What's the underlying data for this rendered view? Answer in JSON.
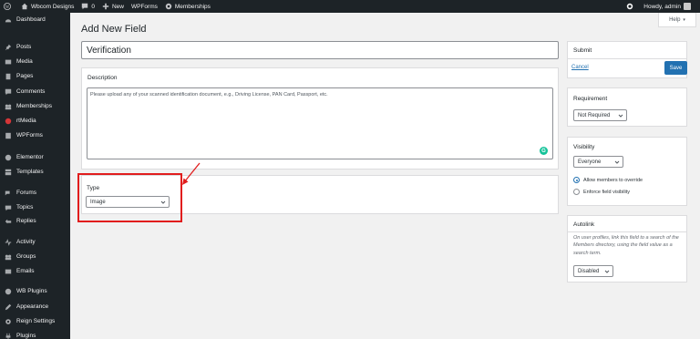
{
  "admin_bar": {
    "site_name": "Wbcom Designs",
    "comments_count": "0",
    "new_label": "New",
    "wpforms_label": "WPForms",
    "memberships_label": "Memberships",
    "howdy": "Howdy, admin"
  },
  "sidebar": {
    "items": [
      {
        "label": "Dashboard",
        "icon": "dashboard-icon"
      },
      {
        "label": "Posts",
        "icon": "pin-icon"
      },
      {
        "label": "Media",
        "icon": "media-icon"
      },
      {
        "label": "Pages",
        "icon": "page-icon"
      },
      {
        "label": "Comments",
        "icon": "comment-icon"
      },
      {
        "label": "Memberships",
        "icon": "memberships-icon"
      },
      {
        "label": "rtMedia",
        "icon": "rtmedia-icon"
      },
      {
        "label": "WPForms",
        "icon": "wpforms-icon"
      },
      {
        "label": "Elementor",
        "icon": "elementor-icon"
      },
      {
        "label": "Templates",
        "icon": "templates-icon"
      },
      {
        "label": "Forums",
        "icon": "forums-icon"
      },
      {
        "label": "Topics",
        "icon": "topics-icon"
      },
      {
        "label": "Replies",
        "icon": "replies-icon"
      },
      {
        "label": "Activity",
        "icon": "activity-icon"
      },
      {
        "label": "Groups",
        "icon": "groups-icon"
      },
      {
        "label": "Emails",
        "icon": "email-icon"
      },
      {
        "label": "WB Plugins",
        "icon": "wb-plugins-icon"
      },
      {
        "label": "Appearance",
        "icon": "appearance-icon"
      },
      {
        "label": "Reign Settings",
        "icon": "settings-icon"
      },
      {
        "label": "Plugins",
        "icon": "plugins-icon"
      }
    ]
  },
  "help_tab": "Help",
  "page_title": "Add New Field",
  "field_name": "Verification",
  "description": {
    "heading": "Description",
    "text": "Please upload any of your scanned identification document, e.g., Driving License, PAN Card, Passport, etc."
  },
  "type": {
    "heading": "Type",
    "selected": "Image"
  },
  "submit": {
    "heading": "Submit",
    "cancel": "Cancel",
    "save": "Save"
  },
  "requirement": {
    "heading": "Requirement",
    "selected": "Not Required"
  },
  "visibility": {
    "heading": "Visibility",
    "selected": "Everyone",
    "options": [
      {
        "label": "Allow members to override",
        "checked": true
      },
      {
        "label": "Enforce field visibility",
        "checked": false
      }
    ]
  },
  "autolink": {
    "heading": "Autolink",
    "description": "On user profiles, link this field to a search of the Members directory, using the field value as a search term.",
    "selected": "Disabled"
  },
  "colors": {
    "primary": "#2271b1",
    "sidebar_bg": "#1d2327",
    "highlight": "#e11d1d",
    "grammarly": "#15c39a"
  }
}
